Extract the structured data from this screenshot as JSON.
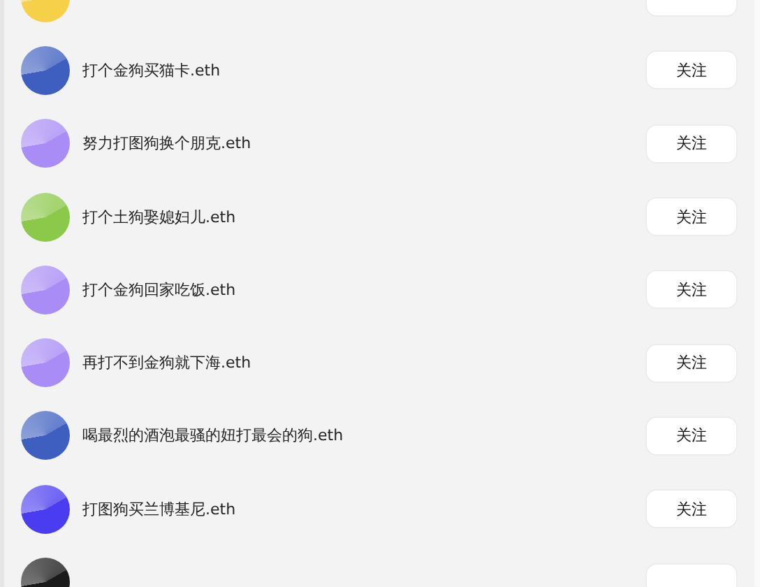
{
  "users": [
    {
      "color": "#f7d04a"
    },
    {
      "name": "打个金狗买猫卡.eth",
      "color": "#3f5fc0",
      "button": "关注"
    },
    {
      "name": "努力打图狗换个朋克.eth",
      "color": "#a98cf5",
      "button": "关注"
    },
    {
      "name": "打个土狗娶媳妇儿.eth",
      "color": "#8cc84a",
      "button": "关注"
    },
    {
      "name": "打个金狗回家吃饭.eth",
      "color": "#a98cf5",
      "button": "关注"
    },
    {
      "name": "再打不到金狗就下海.eth",
      "color": "#a98cf5",
      "button": "关注"
    },
    {
      "name": "喝最烈的酒泡最骚的妞打最会的狗.eth",
      "color": "#3f5fc0",
      "button": "关注"
    },
    {
      "name": "打图狗买兰博基尼.eth",
      "color": "#4a3cf0",
      "button": "关注"
    },
    {
      "color": "#1a1a1a"
    }
  ]
}
